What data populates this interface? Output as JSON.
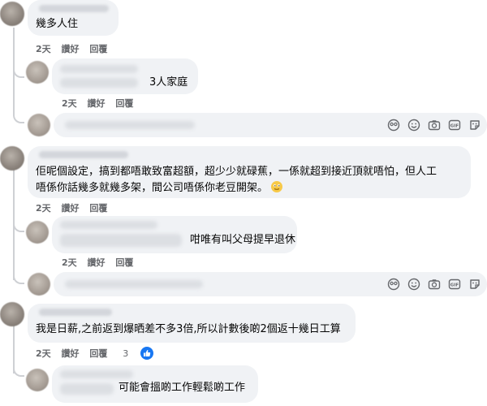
{
  "actions": {
    "like": "讚好",
    "reply": "回覆",
    "age": "2天"
  },
  "comments": [
    {
      "text": "幾多人住"
    },
    {
      "text": "3人家庭"
    },
    {
      "line1": "佢呢個設定，搞到都唔敢致富超額，超少少就碌蕉，一係就超到接近頂就唔怕，但人工",
      "line2": "唔係你話幾多就幾多架，間公司唔係你老豆開架。"
    },
    {
      "text": "咁唯有叫父母提早退休"
    },
    {
      "text": "我是日薪,之前返到爆晒差不多3倍,所以計數後啲2個返十幾日工算",
      "likes": "3"
    },
    {
      "text": "可能會搵啲工作輕鬆啲工作"
    }
  ],
  "icons": {
    "reply_box": [
      "sticker-icon",
      "emoji-icon",
      "camera-icon",
      "gif-icon",
      "avatar-sticker-icon"
    ],
    "like": "thumbs-up-icon",
    "emoji": "face-emoji-icon"
  },
  "colors": {
    "bubble": "#f0f2f5",
    "meta": "#65676b",
    "like_blue": "#1877f2"
  }
}
